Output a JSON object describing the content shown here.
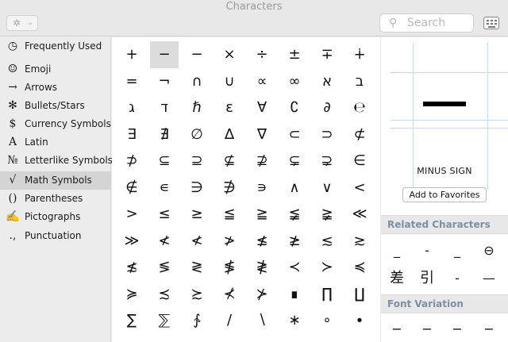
{
  "window": {
    "title": "Characters"
  },
  "toolbar": {
    "gear_glyph": "✲",
    "chevron": "⌄",
    "search_placeholder": "Search",
    "search_glyph": "⚲"
  },
  "sidebar": {
    "items": [
      {
        "icon": "◷",
        "label": "Frequently Used"
      },
      {
        "icon": "☺",
        "label": "Emoji"
      },
      {
        "icon": "→",
        "label": "Arrows"
      },
      {
        "icon": "✻",
        "label": "Bullets/Stars"
      },
      {
        "icon": "$",
        "label": "Currency Symbols"
      },
      {
        "icon": "A",
        "label": "Latin"
      },
      {
        "icon": "№",
        "label": "Letterlike Symbols"
      },
      {
        "icon": "√",
        "label": "Math Symbols"
      },
      {
        "icon": "()",
        "label": "Parentheses"
      },
      {
        "icon": "✍",
        "label": "Pictographs"
      },
      {
        "icon": ".,",
        "label": "Punctuation"
      }
    ],
    "selected_index": 7
  },
  "grid": {
    "rows": [
      [
        "+",
        "−",
        "−",
        "×",
        "÷",
        "±",
        "∓",
        "∔"
      ],
      [
        "=",
        "¬",
        "∩",
        "∪",
        "∝",
        "∞",
        "א",
        "ב"
      ],
      [
        "ג",
        "ד",
        "ℏ",
        "ε",
        "∀",
        "∁",
        "∂",
        "℮"
      ],
      [
        "∃",
        "∄",
        "∅",
        "∆",
        "∇",
        "⊂",
        "⊃",
        "⊄"
      ],
      [
        "⊅",
        "⊆",
        "⊇",
        "⊈",
        "⊉",
        "⊊",
        "⊋",
        "∈"
      ],
      [
        "∉",
        "∊",
        "∋",
        "∌",
        "∍",
        "∧",
        "∨",
        "<"
      ],
      [
        ">",
        "≤",
        "≥",
        "≦",
        "≧",
        "≨",
        "≩",
        "≪"
      ],
      [
        "≫",
        "≮",
        "≮",
        "≯",
        "≰",
        "≱",
        "≲",
        "≳"
      ],
      [
        "≴",
        "≶",
        "≷",
        "≸",
        "≹",
        "≺",
        "≻",
        "≼"
      ],
      [
        "≽",
        "≾",
        "≿",
        "⊀",
        "⊁",
        "∎",
        "∏",
        "∐"
      ],
      [
        "∑",
        "⅀",
        "∱",
        "∕",
        "∖",
        "∗",
        "∘",
        "∙"
      ]
    ],
    "selected": [
      0,
      1
    ]
  },
  "detail": {
    "name": "MINUS SIGN",
    "add_button": "Add to Favorites",
    "related_title": "Related Characters",
    "related": [
      "_",
      "-",
      "_",
      "⊖",
      "差",
      "引",
      "-",
      "—"
    ],
    "font_variation_title": "Font Variation",
    "font_variations": [
      "−",
      "−",
      "−",
      "−"
    ]
  }
}
